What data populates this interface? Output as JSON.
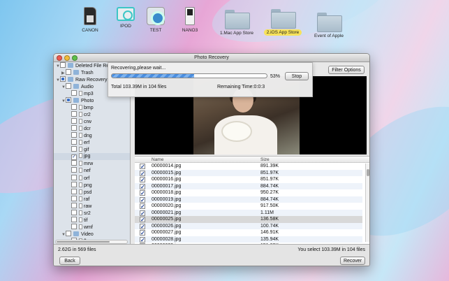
{
  "desktop": {
    "icons": [
      {
        "label": "CANON",
        "type": "sd-card",
        "selected": false
      },
      {
        "label": "IPOD",
        "type": "ipod-shuffle",
        "selected": false
      },
      {
        "label": "TEST",
        "type": "ipod-classic",
        "selected": false
      },
      {
        "label": "NANO3",
        "type": "ipod-nano",
        "selected": false
      },
      {
        "label": "1.Mac App Store",
        "type": "folder",
        "selected": false
      },
      {
        "label": "2.iOS App Store",
        "type": "folder",
        "selected": true
      },
      {
        "label": "Event of Apple",
        "type": "folder",
        "selected": false
      }
    ]
  },
  "window": {
    "title": "Photo Recovery",
    "filter_button": "Filter Options",
    "tree": {
      "root": "Deleted File Re",
      "trash": "Trash",
      "raw_recovery": "Raw Recovery",
      "audio": "Audio",
      "mp3": "mp3",
      "photo": "Photo",
      "photo_types": [
        "bmp",
        "cr2",
        "crw",
        "dcr",
        "dng",
        "erf",
        "gif",
        "jpg",
        "mrw",
        "nef",
        "orf",
        "png",
        "psd",
        "raf",
        "raw",
        "sr2",
        "tif",
        "wmf"
      ],
      "checked_type": "jpg",
      "video": "Video",
      "flv": "flv"
    },
    "list": {
      "col_name": "Name",
      "col_size": "Size",
      "rows": [
        {
          "name": "00000014.jpg",
          "size": "891.39K"
        },
        {
          "name": "00000015.jpg",
          "size": "851.97K"
        },
        {
          "name": "00000016.jpg",
          "size": "851.97K"
        },
        {
          "name": "00000017.jpg",
          "size": "884.74K"
        },
        {
          "name": "00000018.jpg",
          "size": "950.27K"
        },
        {
          "name": "00000019.jpg",
          "size": "884.74K"
        },
        {
          "name": "00000020.jpg",
          "size": "917.50K"
        },
        {
          "name": "00000021.jpg",
          "size": "1.11M"
        },
        {
          "name": "00000025.jpg",
          "size": "136.58K"
        },
        {
          "name": "00000026.jpg",
          "size": "100.74K"
        },
        {
          "name": "00000027.jpg",
          "size": "146.91K"
        },
        {
          "name": "00000028.jpg",
          "size": "135.94K"
        },
        {
          "name": "00000029.jpg",
          "size": "151.82K"
        }
      ],
      "highlighted_index": 8
    },
    "footer": {
      "left_text": "2.62G in  569 files",
      "right_text": "You select 103.39M in 104 files",
      "back_button": "Back",
      "recover_button": "Recover"
    },
    "progress": {
      "title": "Recovering,please wait...",
      "percent": 53,
      "percent_text": "53%",
      "stop_button": "Stop",
      "total_text": "Total 103.39M in 104 files",
      "remaining_text": "Remaining Time:0:0:3"
    }
  },
  "colors": {
    "selected_label": "#f7e25a",
    "progress_fill": "#4a8ee0",
    "sidebar_bg": "#dde3ea"
  }
}
